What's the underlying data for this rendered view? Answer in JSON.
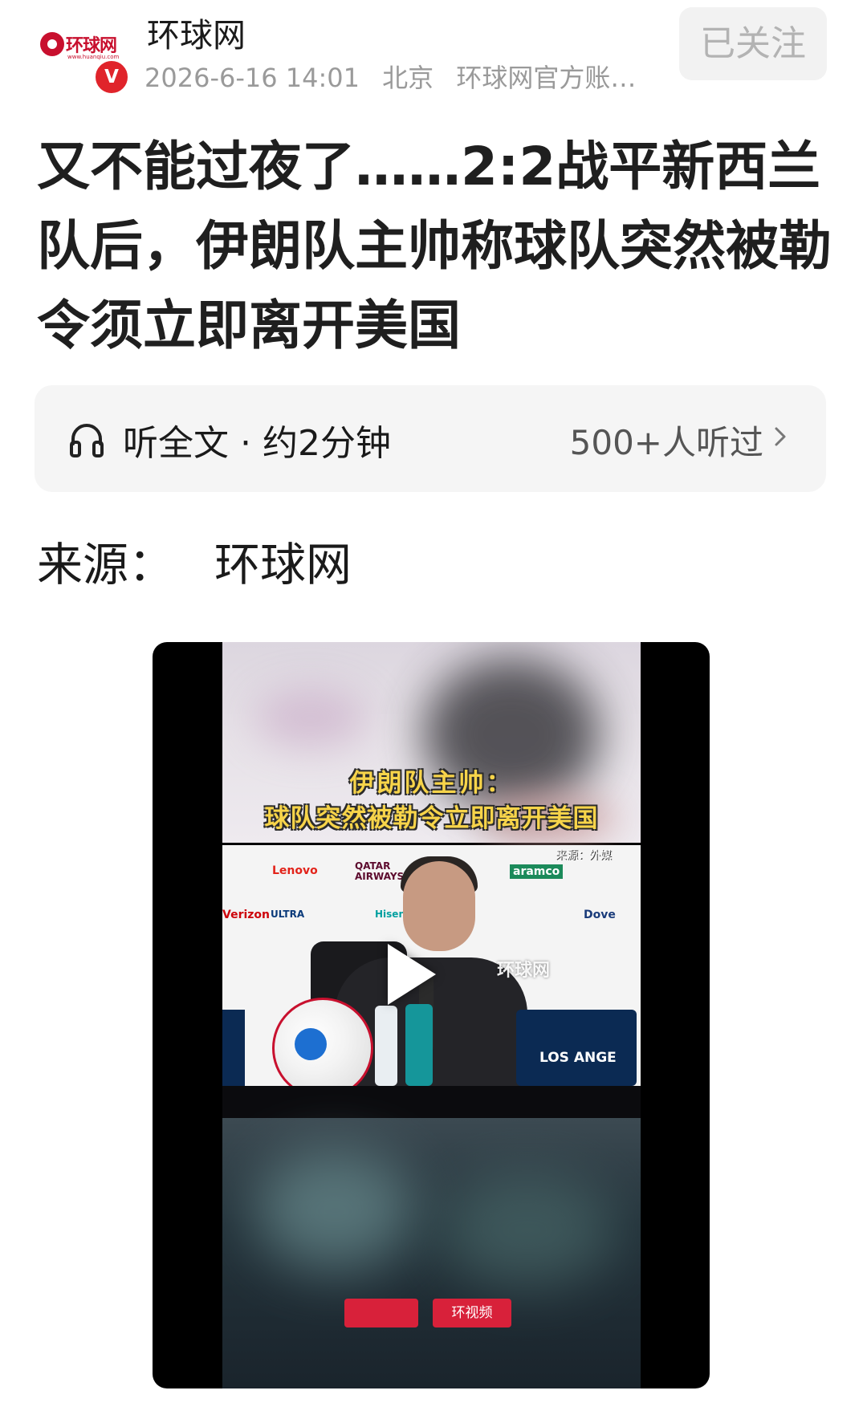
{
  "header": {
    "author": "环球网",
    "logo_text": "环球网",
    "logo_sub": "www.huanqiu.com",
    "verified_badge": "V",
    "meta": {
      "datetime": "2026-6-16 14:01",
      "location": "北京",
      "account": "环球网官方账…"
    },
    "follow_label": "已关注"
  },
  "article": {
    "title": "又不能过夜了……2:2战平新西兰队后，伊朗队主帅称球队突然被勒令须立即离开美国",
    "listen": {
      "label": "听全文 · 约2分钟",
      "count": "500+人听过"
    },
    "source": {
      "label": "来源：",
      "name": "环球网"
    }
  },
  "video": {
    "caption_line1": "伊朗队主帅：",
    "caption_line2": "球队突然被勒令立即离开美国",
    "source_tag": "来源：外媒",
    "watermark": "环球网",
    "brand_tag": "环视频",
    "sponsors": [
      "Lenovo",
      "QATAR AIRWAYS",
      "aramco",
      "Verizon",
      "ULTRA",
      "Hisense",
      "Dove",
      "LOS ANGE"
    ]
  },
  "colors": {
    "brand_red": "#c8102e",
    "caption_yellow": "#f7d44a",
    "muted_text": "#9a9a9a"
  }
}
